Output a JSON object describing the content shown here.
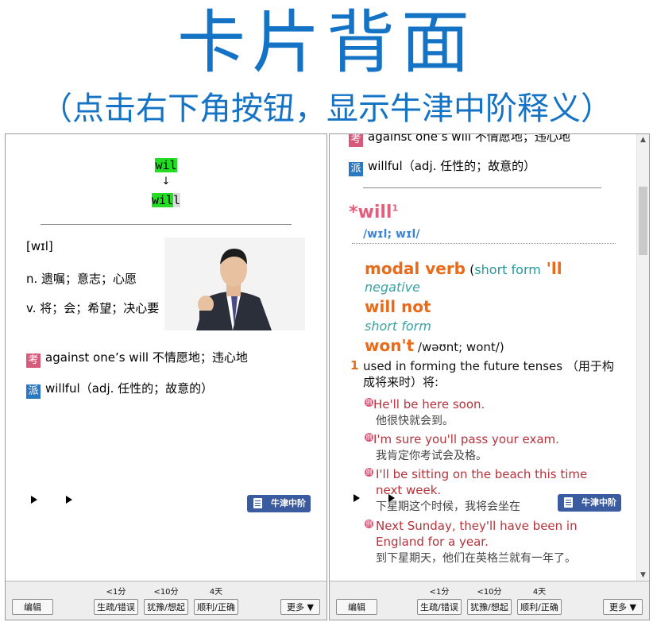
{
  "title": "卡片背面",
  "subtitle": "（点击右下角按钮，显示牛津中阶释义）",
  "left_card": {
    "word_top": "wil",
    "arrow": "↓",
    "word_green": "wil",
    "word_gray": "l",
    "phonetic": "[wɪl]",
    "def_n": "n. 遗嘱；意志；心愿",
    "def_v": "v. 将；会；希望；决心要",
    "tag_kao": "考",
    "kao_text_en": "against one’s will",
    "kao_text_zh": " 不情愿地；违心地",
    "tag_pai": "派",
    "pai_text": "willful（adj. 任性的；故意的）",
    "oxford_button": "牛津中阶"
  },
  "right_card": {
    "cut_text": "against one’s will 不情愿地；违心地",
    "tag_kao": "考",
    "tag_pai": "派",
    "pai_text": "willful（adj. 任性的；故意的）",
    "headword": "*will",
    "headword_sup": "1",
    "pron": "/wɪl; wɪl/",
    "pos": "modal verb",
    "short_form_open": " (",
    "short_form_label": "short form",
    "short_form_val": " 'll",
    "negative_label": "negative",
    "will_not": "will not",
    "short_form_label2": "short form",
    "wont": "won't",
    "wont_pron": " /wəʊnt; wont/)",
    "sense_num": "1",
    "sense_text": "used in forming the future tenses （用于构成将来时）将:",
    "examples": [
      {
        "en": "He'll be here soon.",
        "zh": "他很快就会到。"
      },
      {
        "en": "I'm sure you'll pass your exam.",
        "zh": "我肯定你考试会及格。"
      },
      {
        "en": "I'll be sitting on the beach this time next week.",
        "zh": "下星期这个时候，我将会坐在"
      },
      {
        "en": "Next Sunday, they'll have been in England for a year.",
        "zh": "到下星期天，他们在英格兰就有一年了。"
      }
    ],
    "example_mark": "例",
    "oxford_button": "牛津中阶"
  },
  "toolbar": {
    "edit": "编辑",
    "lbl1": "<1分",
    "lbl2": "<10分",
    "lbl3": "4天",
    "btn1": "生疏/错误",
    "btn2": "犹豫/想起",
    "btn3": "顺利/正确",
    "more": "更多 ▼"
  }
}
